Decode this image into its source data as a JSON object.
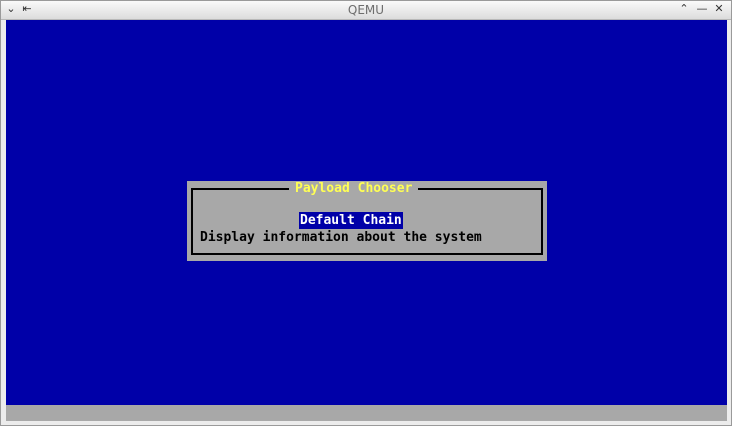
{
  "window": {
    "title": "QEMU",
    "left_buttons": [
      "chevron-down-icon",
      "pin-icon"
    ],
    "right_buttons": [
      "chevron-up-icon",
      "minimize-icon",
      "close-icon"
    ]
  },
  "screen": {
    "background_color": "#0000a8",
    "dialog": {
      "title": "Payload Chooser",
      "title_color": "#ffff54",
      "background_color": "#a8a8a8",
      "items": [
        {
          "label": "Default Chain",
          "selected": true
        },
        {
          "label": "Display information about the system",
          "selected": false
        }
      ]
    }
  }
}
